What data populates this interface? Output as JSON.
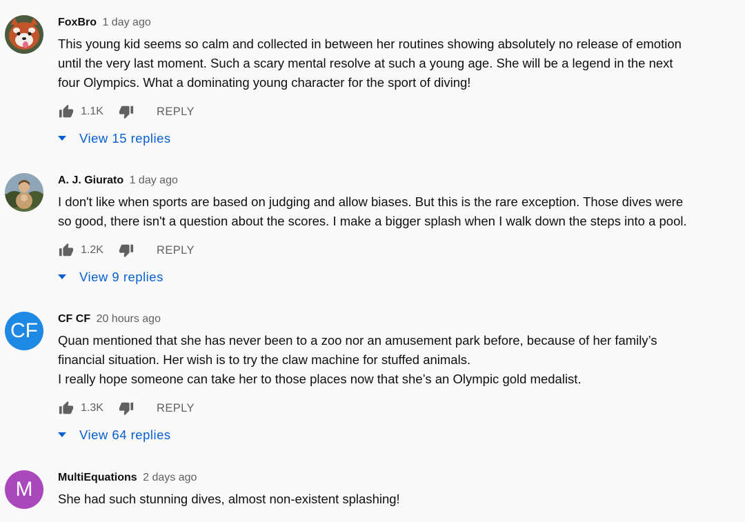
{
  "colors": {
    "background": "#f9f9f9",
    "link_blue": "#065fd4",
    "icon_gray": "#606060",
    "avatar_cf": "#1e88e5",
    "avatar_m": "#ab47bc"
  },
  "icons": {
    "like": "thumb-up-icon",
    "dislike": "thumb-down-icon",
    "expand": "caret-down-icon"
  },
  "comments": [
    {
      "author": "FoxBro",
      "time": "1 day ago",
      "avatar": {
        "type": "image",
        "subject": "red panda"
      },
      "lines": [
        "This young kid seems so calm and collected in between her routines showing absolutely no release of emotion",
        "until the very last moment. Such a scary mental resolve at such a young age. She will be a legend in the next",
        "four Olympics. What a dominating young character for the sport of diving!"
      ],
      "likes": "1.1K",
      "reply_label": "REPLY",
      "view_replies": "View 15 replies"
    },
    {
      "author": "A. J. Giurato",
      "time": "1 day ago",
      "avatar": {
        "type": "image",
        "subject": "person outdoors"
      },
      "lines": [
        "I don't like when sports are based on judging and allow biases.  But this is the rare exception.  Those dives were",
        "so good, there isn't a question about the scores.  I make a bigger splash when I walk down the steps into a pool."
      ],
      "likes": "1.2K",
      "reply_label": "REPLY",
      "view_replies": "View 9 replies"
    },
    {
      "author": "CF CF",
      "time": "20 hours ago",
      "avatar": {
        "type": "letters",
        "text": "CF"
      },
      "lines": [
        "Quan mentioned that she has never been to a zoo nor an amusement park before, because of her family’s",
        "financial situation.  Her wish is to try the claw machine for stuffed animals.",
        "I really hope someone can take her to those places now that she’s an Olympic gold medalist."
      ],
      "likes": "1.3K",
      "reply_label": "REPLY",
      "view_replies": "View 64 replies"
    },
    {
      "author": "MultiEquations",
      "time": "2 days ago",
      "avatar": {
        "type": "letters",
        "text": "M"
      },
      "lines": [
        "She had such stunning dives, almost non-existent splashing!"
      ]
    }
  ]
}
